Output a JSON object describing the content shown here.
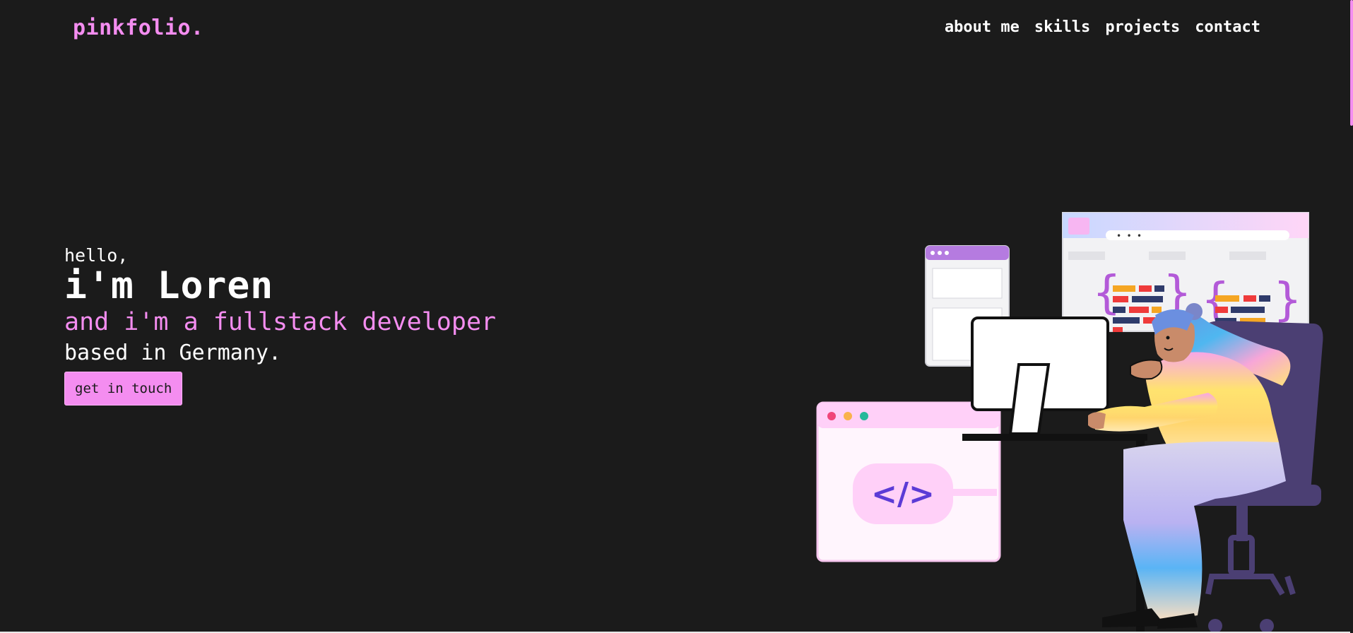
{
  "brand": {
    "logo": "pinkfolio."
  },
  "nav": {
    "items": [
      {
        "label": "about me"
      },
      {
        "label": "skills"
      },
      {
        "label": "projects"
      },
      {
        "label": "contact"
      }
    ]
  },
  "hero": {
    "greeting": "hello,",
    "name": "i'm Loren",
    "role": "and i'm a fullstack developer",
    "location": "based in Germany.",
    "cta_label": "get in touch"
  },
  "illustration": {
    "code_symbol": "</>",
    "dots_label": "• • •"
  },
  "colors": {
    "background": "#1b1b1b",
    "accent_pink": "#f48df0",
    "text": "#ffffff",
    "chair": "#4b3f73",
    "code_purple": "#5b3bd6"
  }
}
